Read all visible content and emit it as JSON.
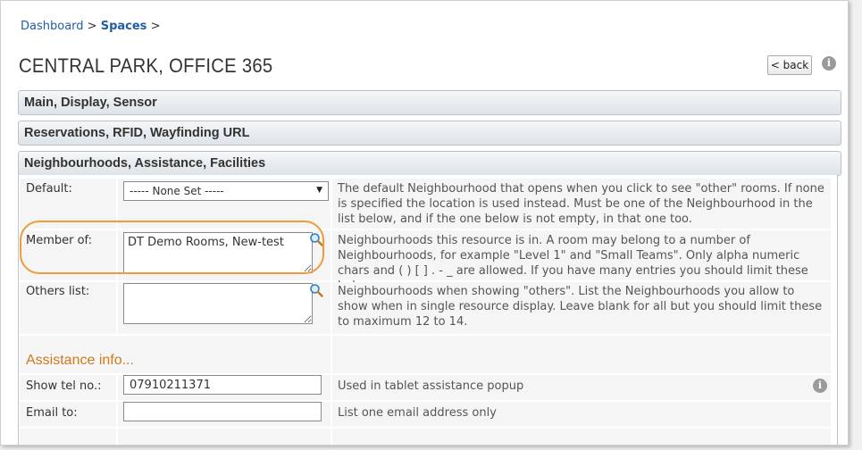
{
  "breadcrumb": {
    "dashboard": "Dashboard",
    "sep1": ">",
    "spaces": "Spaces",
    "sep2": ">"
  },
  "page_title": "CENTRAL PARK, OFFICE 365",
  "back_button": "< back",
  "sections": {
    "main": "Main, Display, Sensor",
    "reservations": "Reservations, RFID, Wayfinding URL",
    "neighbourhoods": "Neighbourhoods, Assistance, Facilities"
  },
  "fields": {
    "default": {
      "label": "Default:",
      "selected": "----- None Set -----",
      "help": "The default Neighbourhood that opens when you click to see \"other\" rooms. If none is specified the location is used instead. Must be one of the Neighbourhood in the list below, and if the one below is not empty, in that one too."
    },
    "member_of": {
      "label": "Member of:",
      "value": "DT Demo Rooms, New-test",
      "help": "Neighbourhoods this resource is in. A room may belong to a number of Neighbourhoods, for example \"Level 1\" and \"Small Teams\". Only alpha numeric chars and ( ) [ ] . - _ are allowed. If you have many entries you should limit these below."
    },
    "others_list": {
      "label": "Others list:",
      "value": "",
      "help": "Neighbourhoods when showing \"others\". List the Neighbourhoods you allow to show when in single resource display. Leave blank for all but you should limit these to maximum 12 to 14."
    },
    "assistance_heading": "Assistance info...",
    "show_tel": {
      "label": "Show tel no.:",
      "value": "07910211371",
      "help": "Used in tablet assistance popup"
    },
    "email_to": {
      "label": "Email to:",
      "value": "",
      "help": "List one email address only"
    }
  },
  "colors": {
    "link": "#1f5ea8",
    "accent_orange": "#ef9b3a",
    "heading_orange": "#d07a1c"
  },
  "icons": {
    "info": "info-icon",
    "search": "search-icon",
    "dropdown": "chevron-down-icon"
  },
  "info_glyph": "i",
  "dropdown_glyph": "▼"
}
